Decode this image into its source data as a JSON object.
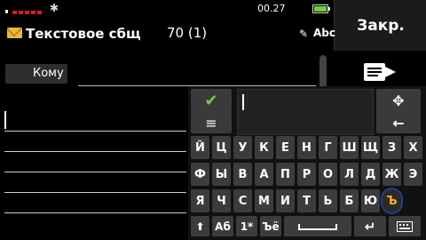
{
  "status": {
    "time": "00.27"
  },
  "close_label": "Закр.",
  "header": {
    "type": "Текстовое сбщ",
    "counter": "70 (1)",
    "input_mode": "Abc"
  },
  "to_label": "Кому",
  "keyboard": {
    "row1": [
      "Й",
      "Ц",
      "У",
      "К",
      "Е",
      "Н",
      "Г",
      "Ш",
      "Щ",
      "З",
      "Х"
    ],
    "row2": [
      "Ф",
      "Ы",
      "В",
      "А",
      "П",
      "Р",
      "О",
      "Л",
      "Д",
      "Ж",
      "Э"
    ],
    "row3": [
      "Я",
      "Ч",
      "С",
      "М",
      "И",
      "Т",
      "Ь",
      "Б",
      "Ю",
      "Ъ"
    ],
    "shift_symbol": "⬆",
    "lang_label": "Аб",
    "sym_label": "1*",
    "special_label": "Ъё",
    "backspace_symbol": "←",
    "move_symbol": "✥",
    "menu_symbol": "≡",
    "ok_symbol": "✔",
    "enter_symbol": "↵"
  },
  "colors": {
    "accent": "#6fcf3a",
    "signal": "#e01818",
    "highlight": "#f0b020"
  },
  "icons": [
    "envelope-icon",
    "bluetooth-icon",
    "battery-icon",
    "send-icon",
    "pen-icon",
    "keyboard-icon",
    "space-icon"
  ]
}
